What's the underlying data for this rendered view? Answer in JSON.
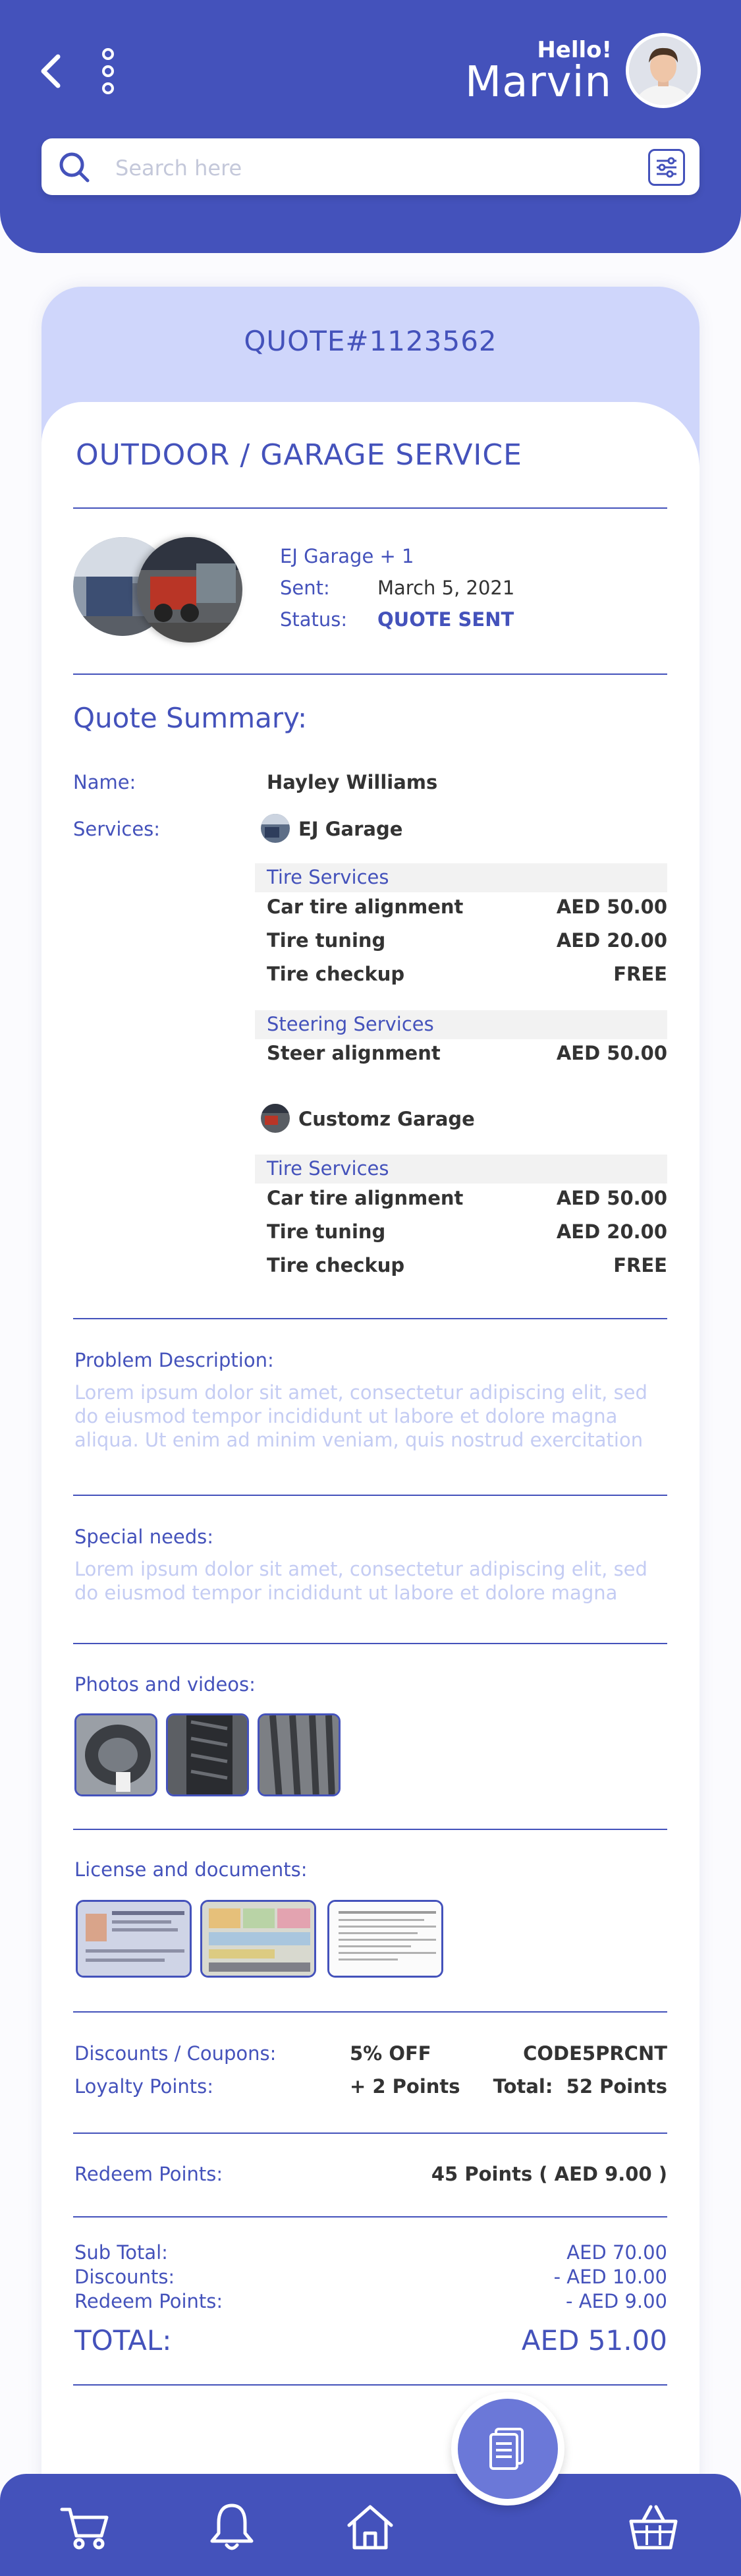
{
  "header": {
    "greeting": "Hello!",
    "user_name": "Marvin",
    "search_placeholder": "Search here"
  },
  "quote": {
    "number": "QUOTE#1123562",
    "service_title": "OUTDOOR / GARAGE SERVICE",
    "garages": "EJ Garage + 1",
    "sent_label": "Sent:",
    "sent_value": "March 5, 2021",
    "status_label": "Status:",
    "status_value": "QUOTE SENT"
  },
  "summary": {
    "heading": "Quote Summary:",
    "name_label": "Name:",
    "name_value": "Hayley Williams",
    "services_label": "Services:",
    "garages": [
      {
        "name": "EJ Garage",
        "categories": [
          {
            "title": "Tire Services",
            "items": [
              {
                "name": "Car tire alignment",
                "price": "AED 50.00"
              },
              {
                "name": "Tire tuning",
                "price": "AED 20.00"
              },
              {
                "name": "Tire checkup",
                "price": "FREE"
              }
            ]
          },
          {
            "title": "Steering Services",
            "items": [
              {
                "name": "Steer alignment",
                "price": "AED 50.00"
              }
            ]
          }
        ]
      },
      {
        "name": "Customz Garage",
        "categories": [
          {
            "title": "Tire Services",
            "items": [
              {
                "name": "Car tire alignment",
                "price": "AED 50.00"
              },
              {
                "name": "Tire tuning",
                "price": "AED 20.00"
              },
              {
                "name": "Tire checkup",
                "price": "FREE"
              }
            ]
          }
        ]
      }
    ]
  },
  "problem": {
    "label": "Problem Description:",
    "text": "Lorem ipsum dolor sit amet, consectetur adipiscing elit, sed do eiusmod tempor incididunt ut labore et dolore magna aliqua. Ut enim ad minim veniam, quis nostrud exercitation"
  },
  "special": {
    "label": "Special needs:",
    "text": "Lorem ipsum dolor sit amet, consectetur adipiscing elit, sed do eiusmod tempor incididunt ut labore et dolore magna"
  },
  "photos_label": "Photos and videos:",
  "docs_label": "License and documents:",
  "discounts": {
    "coupon_label": "Discounts / Coupons:",
    "coupon_value": "5% OFF",
    "coupon_code": "CODE5PRCNT",
    "loyalty_label": "Loyalty Points:",
    "loyalty_value": "+ 2 Points",
    "loyalty_total": "Total:  52 Points",
    "redeem_label": "Redeem Points:",
    "redeem_value": "45 Points ( AED 9.00 )"
  },
  "totals": {
    "subtotal_label": "Sub Total:",
    "subtotal_value": "AED 70.00",
    "discounts_label": "Discounts:",
    "discounts_value": "- AED 10.00",
    "redeem_label": "Redeem Points:",
    "redeem_value": "- AED 9.00",
    "total_label": "TOTAL:",
    "total_value": "AED 51.00"
  },
  "nav": {
    "items": [
      "cart-icon",
      "bell-icon",
      "home-icon",
      "quote-icon",
      "basket-icon"
    ],
    "active": "quote-icon"
  },
  "colors": {
    "primary": "#4452bb",
    "band": "#cfd6fb",
    "placeholder_text": "#c4ccf3"
  }
}
